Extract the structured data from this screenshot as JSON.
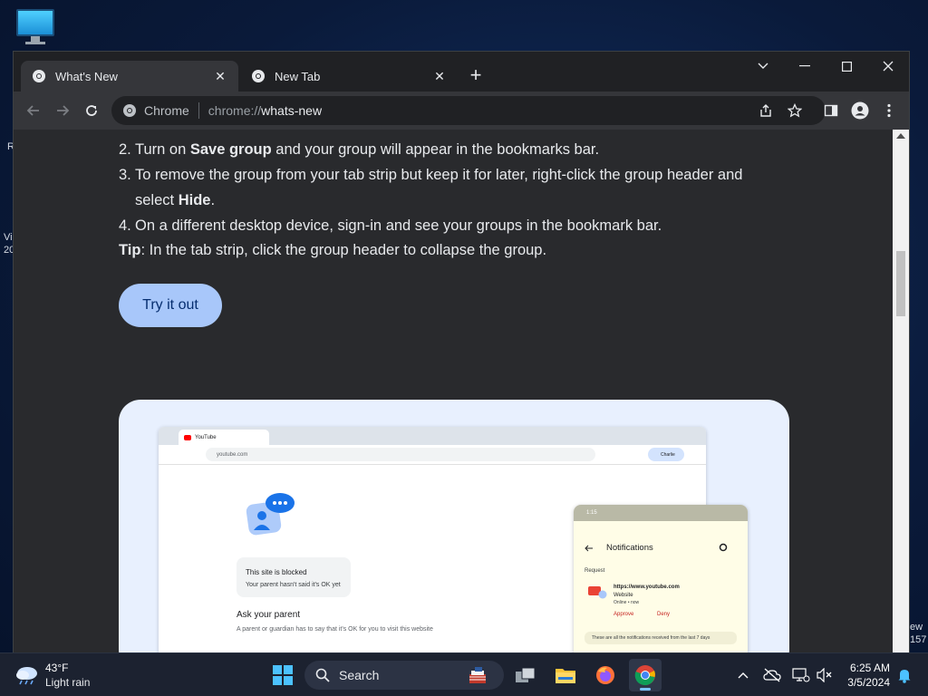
{
  "desktop": {
    "left_fragments": [
      "R",
      "Vi",
      "20"
    ],
    "right_fragments": [
      "ew",
      "157"
    ]
  },
  "browser": {
    "tabs": [
      {
        "label": "What's New",
        "active": true
      },
      {
        "label": "New Tab",
        "active": false
      }
    ],
    "omnibox": {
      "site_label": "Chrome",
      "scheme": "chrome://",
      "host": "whats-new"
    }
  },
  "page": {
    "steps": [
      {
        "num": "2.",
        "pre": "Turn on ",
        "bold": "Save group",
        "post": " and your group will appear in the bookmarks bar."
      },
      {
        "num": "3.",
        "pre": "To remove the group from your tab strip but keep it for later, right-click the group header and select ",
        "bold": "Hide",
        "post": "."
      },
      {
        "num": "4.",
        "pre": "On a different desktop device, sign-in and see your groups in the bookmark bar.",
        "bold": "",
        "post": ""
      }
    ],
    "tip_label": "Tip",
    "tip_text": ": In the tab strip, click the group header to collapse the group.",
    "try_button": "Try it out",
    "illustration": {
      "tab_title": "YouTube",
      "url": "youtube.com",
      "profile": "Charlie",
      "blocked_title": "This site is blocked",
      "blocked_sub": "Your parent hasn't said it's OK yet",
      "ask_title": "Ask your parent",
      "ask_sub": "A parent or guardian has to say that it's OK for you to visit this website",
      "phone": {
        "time": "1:15",
        "title": "Notifications",
        "request": "Request",
        "url": "https://www.youtube.com",
        "site_type": "Website",
        "status": "Online • now",
        "approve": "Approve",
        "deny": "Deny",
        "footer": "These are all the notifications received from the last 7 days"
      }
    }
  },
  "taskbar": {
    "weather_temp": "43°F",
    "weather_cond": "Light rain",
    "search_label": "Search",
    "time": "6:25 AM",
    "date": "3/5/2024"
  }
}
